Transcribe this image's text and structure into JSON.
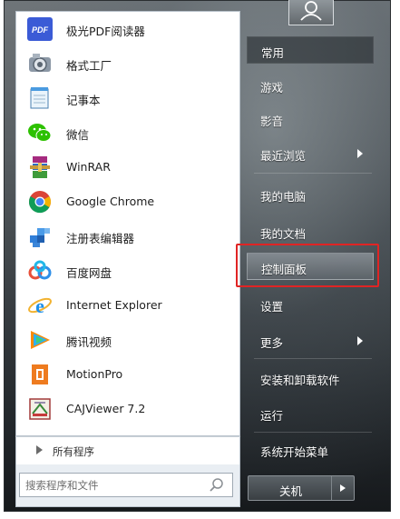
{
  "programs": [
    {
      "label": "极光PDF阅读器",
      "icon": "pdf-reader-icon"
    },
    {
      "label": "格式工厂",
      "icon": "format-factory-icon"
    },
    {
      "label": "记事本",
      "icon": "notepad-icon"
    },
    {
      "label": "微信",
      "icon": "wechat-icon"
    },
    {
      "label": "WinRAR",
      "icon": "winrar-icon"
    },
    {
      "label": "Google Chrome",
      "icon": "chrome-icon"
    },
    {
      "label": "注册表编辑器",
      "icon": "registry-editor-icon"
    },
    {
      "label": "百度网盘",
      "icon": "baidu-netdisk-icon"
    },
    {
      "label": "Internet Explorer",
      "icon": "internet-explorer-icon"
    },
    {
      "label": "腾讯视频",
      "icon": "tencent-video-icon"
    },
    {
      "label": "MotionPro",
      "icon": "motionpro-icon"
    },
    {
      "label": "CAJViewer 7.2",
      "icon": "cajviewer-icon"
    }
  ],
  "pdf_icon_text": "PDF",
  "all_programs_label": "所有程序",
  "search": {
    "placeholder": "搜索程序和文件",
    "value": ""
  },
  "right_menu": [
    {
      "label": "常用"
    },
    {
      "label": "游戏"
    },
    {
      "label": "影音"
    },
    {
      "label": "最近浏览"
    },
    {
      "label": "我的电脑"
    },
    {
      "label": "我的文档"
    },
    {
      "label": "控制面板"
    },
    {
      "label": "设置"
    },
    {
      "label": "更多"
    },
    {
      "label": "安装和卸载软件"
    },
    {
      "label": "运行"
    },
    {
      "label": "系统开始菜单"
    }
  ],
  "shutdown_label": "关机",
  "colors": {
    "highlight_annotation": "#e02424",
    "pdf_brand": "#3b5bd6"
  }
}
